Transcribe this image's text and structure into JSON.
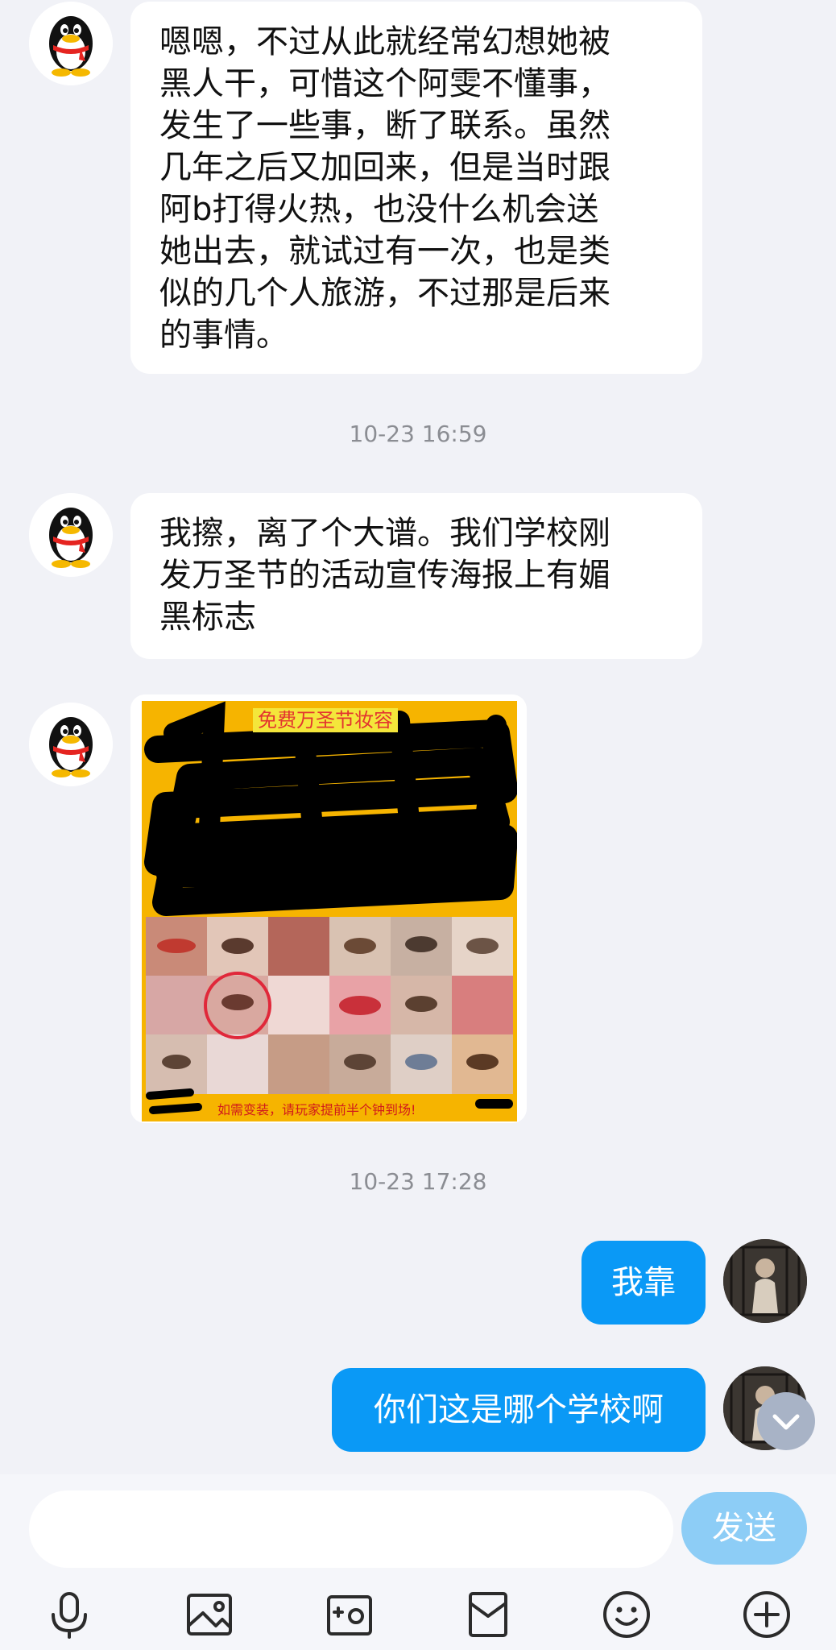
{
  "messages": [
    {
      "text": "嗯嗯，不过从此就经常幻想她被\n黑人干，可惜这个阿雯不懂事，\n发生了一些事，断了联系。虽然\n几年之后又加回来，但是当时跟\n阿b打得火热，也没什么机会送\n她出去，就试过有一次，也是类\n似的几个人旅游，不过那是后来\n的事情。"
    },
    {
      "text": "我擦，离了个大谱。我们学校刚\n发万圣节的活动宣传海报上有媚\n黑标志"
    },
    {
      "poster_title": "免费万圣节妆容",
      "poster_footer": "如需变装，请玩家提前半个钟到场!"
    },
    {
      "text": "我靠"
    },
    {
      "text": "你们这是哪个学校啊"
    }
  ],
  "timestamps": [
    "10-23 16:59",
    "10-23 17:28"
  ],
  "composer": {
    "placeholder": "",
    "send_label": "发送"
  },
  "toolbar": [
    "microphone-icon",
    "image-icon",
    "camera-icon",
    "red-packet-icon",
    "emoji-icon",
    "plus-icon"
  ],
  "colors": {
    "outgoing_bubble": "#0a99f6",
    "incoming_bubble": "#ffffff",
    "background": "#f1f2f7",
    "send_button": "#8dcdf6"
  }
}
